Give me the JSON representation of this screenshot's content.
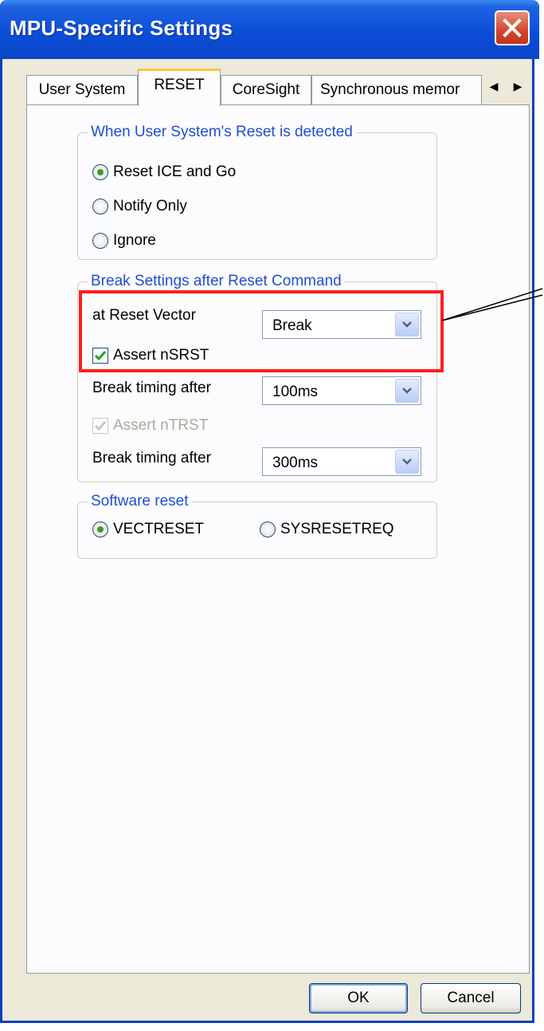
{
  "window": {
    "title": "MPU-Specific Settings"
  },
  "tabs": [
    "User System",
    "RESET",
    "CoreSight",
    "Synchronous memor"
  ],
  "user_reset_group": {
    "legend": "When User System's Reset is detected",
    "options": [
      "Reset ICE and Go",
      "Notify Only",
      "Ignore"
    ],
    "selected": "Reset ICE and Go"
  },
  "break_group": {
    "legend": "Break Settings after Reset Command",
    "reset_vector_label": "at Reset Vector",
    "reset_vector_value": "Break",
    "assert_nsrst_label": "Assert nSRST",
    "break_timing_1_label": "Break timing after",
    "break_timing_1_value": "100ms",
    "assert_ntrst_label": "Assert nTRST",
    "break_timing_2_label": "Break timing after",
    "break_timing_2_value": "300ms"
  },
  "software_reset_group": {
    "legend": "Software reset",
    "options": [
      "VECTRESET",
      "SYSRESETREQ"
    ],
    "selected": "VECTRESET"
  },
  "buttons": {
    "ok": "OK",
    "cancel": "Cancel"
  },
  "colors": {
    "title_bar": "#0a45c8",
    "highlight": "#ff1e1e",
    "group_legend": "#1f4fd1"
  }
}
